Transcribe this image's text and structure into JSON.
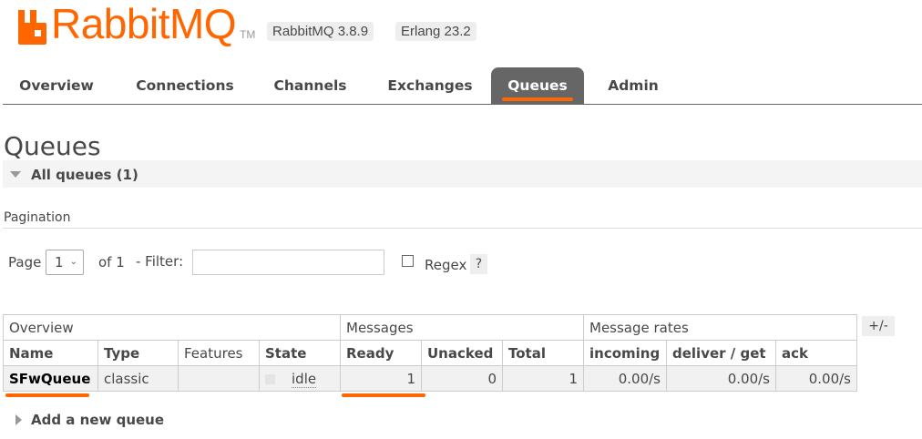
{
  "header": {
    "app_name": "RabbitMQ",
    "trademark": "TM",
    "rabbitmq_version": "RabbitMQ 3.8.9",
    "erlang_version": "Erlang 23.2",
    "brand_color": "#ff6600"
  },
  "tabs": [
    {
      "label": "Overview"
    },
    {
      "label": "Connections"
    },
    {
      "label": "Channels"
    },
    {
      "label": "Exchanges"
    },
    {
      "label": "Queues",
      "active": true
    },
    {
      "label": "Admin"
    }
  ],
  "page": {
    "title": "Queues",
    "section_label": "All queues (1)"
  },
  "pagination": {
    "heading": "Pagination",
    "page_label": "Page",
    "page_value": "1",
    "of_label": "of 1",
    "filter_label": "- Filter:",
    "filter_value": "",
    "regex_label": "Regex",
    "help_label": "?"
  },
  "table": {
    "groups": {
      "overview": "Overview",
      "messages": "Messages",
      "rates": "Message rates"
    },
    "columns_toggle": "+/-",
    "headers": [
      "Name",
      "Type",
      "Features",
      "State",
      "Ready",
      "Unacked",
      "Total",
      "incoming",
      "deliver / get",
      "ack"
    ],
    "rows": [
      {
        "name": "SFwQueue",
        "type": "classic",
        "features": "",
        "state": "idle",
        "ready": "1",
        "unacked": "0",
        "total": "1",
        "incoming": "0.00/s",
        "deliver_get": "0.00/s",
        "ack": "0.00/s"
      }
    ]
  },
  "add_queue_label": "Add a new queue"
}
